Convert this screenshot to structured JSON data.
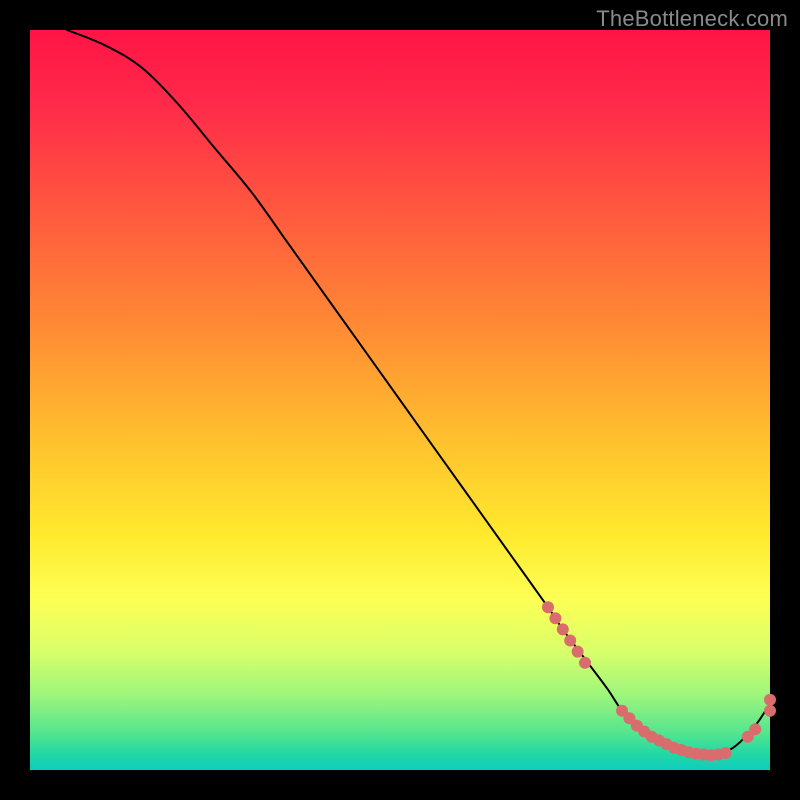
{
  "watermark": "TheBottleneck.com",
  "chart_data": {
    "type": "line",
    "title": "",
    "xlabel": "",
    "ylabel": "",
    "xlim": [
      0,
      100
    ],
    "ylim": [
      0,
      100
    ],
    "grid": false,
    "legend": false,
    "series": [
      {
        "name": "bottleneck-curve",
        "color": "#000000",
        "x": [
          5,
          10,
          15,
          20,
          25,
          30,
          35,
          40,
          45,
          50,
          55,
          60,
          65,
          70,
          72,
          75,
          78,
          80,
          82,
          85,
          88,
          90,
          92,
          95,
          98,
          100
        ],
        "y": [
          100,
          98,
          95,
          90,
          84,
          78,
          71,
          64,
          57,
          50,
          43,
          36,
          29,
          22,
          19,
          15,
          11,
          8,
          6,
          4,
          2.5,
          2,
          2,
          3,
          6,
          9
        ]
      }
    ],
    "markers": {
      "name": "highlight-points",
      "color": "#d96d6d",
      "radius_px": 6,
      "points": [
        {
          "x": 70,
          "y": 22
        },
        {
          "x": 71,
          "y": 20.5
        },
        {
          "x": 72,
          "y": 19
        },
        {
          "x": 73,
          "y": 17.5
        },
        {
          "x": 74,
          "y": 16
        },
        {
          "x": 75,
          "y": 14.5
        },
        {
          "x": 80,
          "y": 8
        },
        {
          "x": 81,
          "y": 7
        },
        {
          "x": 82,
          "y": 6
        },
        {
          "x": 83,
          "y": 5.2
        },
        {
          "x": 84,
          "y": 4.5
        },
        {
          "x": 85,
          "y": 4
        },
        {
          "x": 86,
          "y": 3.5
        },
        {
          "x": 87,
          "y": 3
        },
        {
          "x": 88,
          "y": 2.7
        },
        {
          "x": 89,
          "y": 2.4
        },
        {
          "x": 90,
          "y": 2.2
        },
        {
          "x": 91,
          "y": 2.1
        },
        {
          "x": 92,
          "y": 2
        },
        {
          "x": 93,
          "y": 2.1
        },
        {
          "x": 94,
          "y": 2.3
        },
        {
          "x": 97,
          "y": 4.5
        },
        {
          "x": 98,
          "y": 5.5
        },
        {
          "x": 100,
          "y": 8
        },
        {
          "x": 100,
          "y": 9.5
        }
      ]
    }
  }
}
